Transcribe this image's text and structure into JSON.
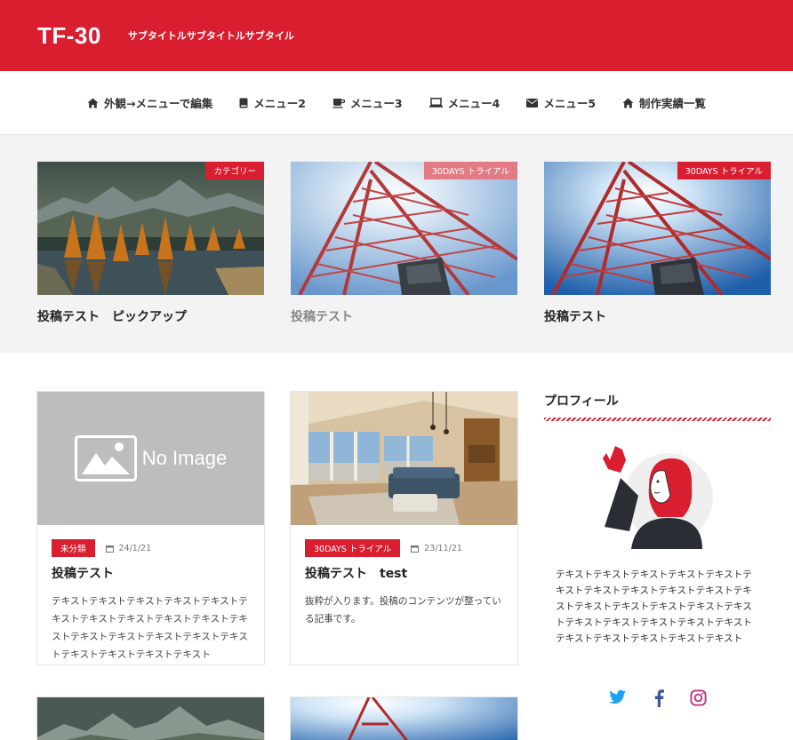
{
  "header": {
    "title": "TF-30",
    "subtitle": "サブタイトルサブタイトルサブタイル"
  },
  "nav": {
    "items": [
      {
        "label": "外観→メニューで編集",
        "icon": "home-icon"
      },
      {
        "label": "メニュー2",
        "icon": "book-icon"
      },
      {
        "label": "メニュー3",
        "icon": "coffee-icon"
      },
      {
        "label": "メニュー4",
        "icon": "laptop-icon"
      },
      {
        "label": "メニュー5",
        "icon": "envelope-icon"
      },
      {
        "label": "制作実績一覧",
        "icon": "home-icon"
      }
    ]
  },
  "pickup": [
    {
      "badge": "カテゴリー",
      "title": "投稿テスト　ピックアップ",
      "image": "mountain-lake"
    },
    {
      "badge": "30DAYS トライアル",
      "title": "投稿テスト",
      "image": "tokyo-tower"
    },
    {
      "badge": "30DAYS トライアル",
      "title": "投稿テスト",
      "image": "tokyo-tower"
    }
  ],
  "posts": [
    {
      "image": "no-image",
      "noimage_text": "No Image",
      "category": "未分類",
      "date": "24/1/21",
      "title": "投稿テスト",
      "excerpt": "テキストテキストテキストテキストテキストテキストテキストテキストテキストテキストテキストテキストテキストテキストテキストテキストテキストテキストテキストテキスト"
    },
    {
      "image": "living-room",
      "category": "30DAYS トライアル",
      "date": "23/11/21",
      "title": "投稿テスト　test",
      "excerpt": "抜粋が入ります。投稿のコンテンツが整っている記事です。"
    }
  ],
  "sidebar": {
    "heading": "プロフィール",
    "text": "テキストテキストテキストテキストテキストテキストテキストテキストテキストテキストテキストテキストテキストテキストテキストテキストテキストテキストテキストテキストテキストテキストテキストテキストテキストテキスト",
    "social": [
      "twitter-icon",
      "facebook-icon",
      "instagram-icon"
    ]
  },
  "colors": {
    "brand": "#d91e30",
    "badge_light": "#e37b85",
    "twitter": "#1da1f2",
    "facebook": "#3b5998",
    "instagram": "#c13584"
  }
}
